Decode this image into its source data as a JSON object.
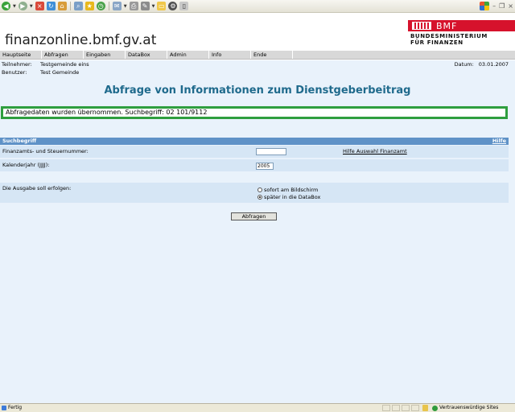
{
  "browser": {
    "toolbar_icons": [
      "back-icon",
      "forward-icon",
      "stop-icon",
      "refresh-icon",
      "home-icon",
      "search-icon",
      "favorites-icon",
      "history-icon",
      "mail-icon",
      "print-icon",
      "edit-icon",
      "folder-icon",
      "tools-icon",
      "page-icon"
    ]
  },
  "header": {
    "site_title": "finanzonline.bmf.gv.at",
    "logo": {
      "name": "BMF",
      "line1": "BUNDESMINISTERIUM",
      "line2": "FÜR FINANZEN",
      "color": "#d6122c"
    }
  },
  "nav": {
    "items": [
      "Hauptseite",
      "Abfragen",
      "Eingaben",
      "DataBox",
      "Admin",
      "Info",
      "Ende"
    ]
  },
  "info": {
    "teilnehmer_label": "Teilnehmer:",
    "teilnehmer_value": "Testgemeinde eins",
    "benutzer_label": "Benutzer:",
    "benutzer_value": "Test Gemeinde",
    "datum_label": "Datum:",
    "datum_value": "03.01.2007"
  },
  "main": {
    "title": "Abfrage von Informationen zum Dienstgeberbeitrag",
    "message": "Abfragedaten wurden übernommen. Suchbegriff: 02 101/9112",
    "section": {
      "title": "Suchbegriff",
      "help": "Hilfe"
    },
    "fields": {
      "steuernummer_label": "Finanzamts- und Steuernummer:",
      "steuernummer_value": "",
      "finanzamt_link": "Hilfe Auswahl Finanzamt",
      "jahr_label": "Kalenderjahr (JJJJ):",
      "jahr_value": "2005"
    },
    "output": {
      "label": "Die Ausgabe soll erfolgen:",
      "option_screen": "sofort am Bildschirm",
      "option_databox": "später in die DataBox",
      "selected": "databox"
    },
    "submit_label": "Abfragen"
  },
  "status": {
    "text": "Fertig",
    "zone": "Vertrauenswürdige Sites"
  },
  "colors": {
    "title": "#1f6a8c",
    "section_header": "#5f92c7",
    "message_border": "#2e9e3e",
    "background": "#e9f2fb"
  }
}
